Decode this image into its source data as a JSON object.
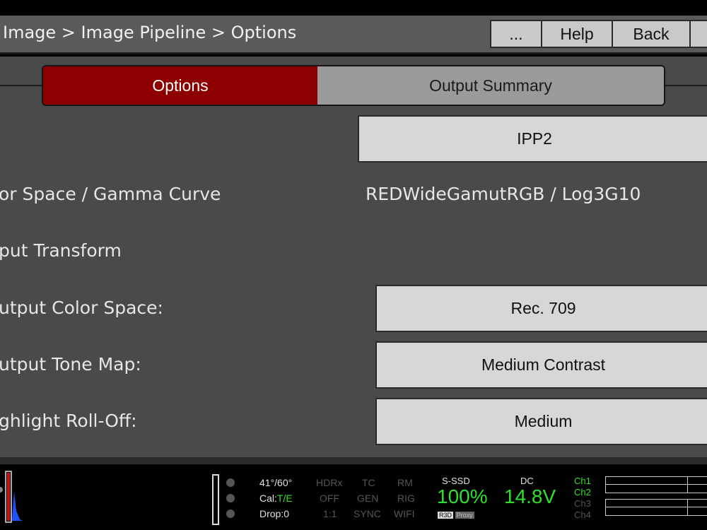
{
  "header": {
    "breadcrumb": "Image > Image Pipeline > Options",
    "buttons": {
      "more": "...",
      "help": "Help",
      "back": "Back"
    }
  },
  "tabs": [
    {
      "label": "Options",
      "active": true
    },
    {
      "label": "Output Summary",
      "active": false
    }
  ],
  "settings": {
    "pipeline_value": "IPP2",
    "color_space_label": "or Space / Gamma Curve",
    "color_space_value": "REDWideGamutRGB / Log3G10",
    "output_transform_label": "put Transform",
    "output_color_space_label": "utput Color Space:",
    "output_color_space_value": "Rec. 709",
    "output_tone_map_label": "utput Tone Map:",
    "output_tone_map_value": "Medium Contrast",
    "highlight_rolloff_label": "ghlight Roll-Off:",
    "highlight_rolloff_value": "Medium"
  },
  "statusbar": {
    "shutter": "41°/60°",
    "cal_label": "Cal:",
    "cal_value": "T/E",
    "drop": "Drop:0",
    "hdrx": "HDRx",
    "hdrx_value": "OFF",
    "aspect": "1:1",
    "tc": "TC",
    "tc_gen": "GEN",
    "sync": "SYNC",
    "rm": "RM",
    "rig": "RIG",
    "wifi": "WIFI",
    "media_label": "S-SSD",
    "media_pct": "100%",
    "r3d": "R3D",
    "proxy": "Proxy",
    "power_label": "DC",
    "voltage": "14.8V",
    "channels": [
      "Ch1",
      "Ch2",
      "Ch3",
      "Ch4"
    ],
    "colors": {
      "green": "#2fe02f",
      "red": "#d01010",
      "accent": "#8e0000"
    }
  }
}
